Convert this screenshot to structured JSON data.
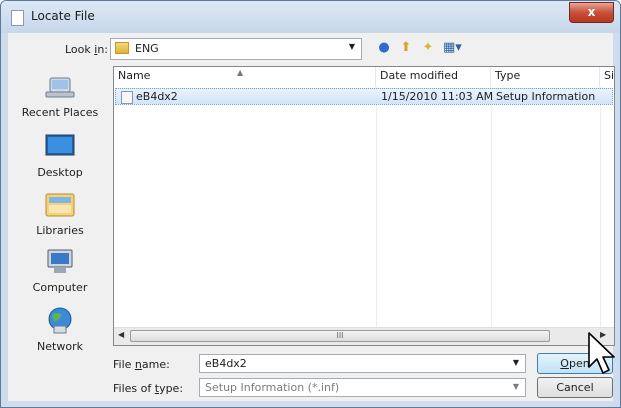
{
  "window": {
    "title": "Locate File",
    "close_label": "x"
  },
  "toolbar": {
    "look_in_label": "Look in:",
    "look_in_value": "ENG",
    "icons": [
      "back-icon",
      "up-folder-icon",
      "new-folder-icon",
      "view-menu-icon"
    ]
  },
  "places": [
    {
      "label": "Recent Places",
      "icon": "recent-places-icon"
    },
    {
      "label": "Desktop",
      "icon": "desktop-icon"
    },
    {
      "label": "Libraries",
      "icon": "libraries-icon"
    },
    {
      "label": "Computer",
      "icon": "computer-icon"
    },
    {
      "label": "Network",
      "icon": "network-icon"
    }
  ],
  "file_list": {
    "columns": [
      "Name",
      "Date modified",
      "Type",
      "Siz"
    ],
    "rows": [
      {
        "name": "eB4dx2",
        "date": "1/15/2010 11:03 AM",
        "type": "Setup Information"
      }
    ],
    "scroll_thumb": "III"
  },
  "file_name": {
    "label": "File name:",
    "value": "eB4dx2"
  },
  "file_type": {
    "label": "Files of type:",
    "value": "Setup Information (*.inf)"
  },
  "buttons": {
    "open": "Open",
    "cancel": "Cancel"
  }
}
